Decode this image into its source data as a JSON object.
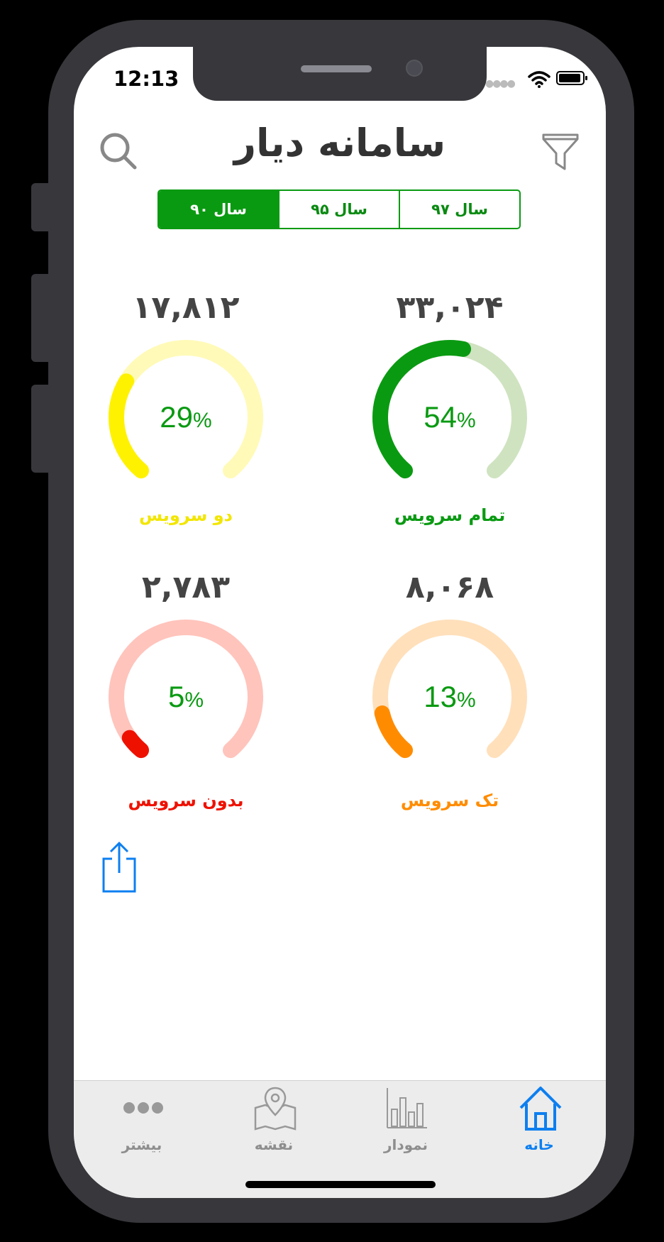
{
  "status_bar": {
    "time": "12:13"
  },
  "header": {
    "title": "سامانه دیار"
  },
  "year_tabs": [
    {
      "label": "سال ۹۷",
      "active": false
    },
    {
      "label": "سال ۹۵",
      "active": false
    },
    {
      "label": "سال ۹۰",
      "active": true
    }
  ],
  "gauges": [
    {
      "id": "full",
      "count": "۳۳,۰۲۴",
      "percent": 54,
      "percent_text": "54",
      "label": "تمام سرویس",
      "color": "#0a9a12",
      "track": "#cfe3c0",
      "label_color": "#0a9a12"
    },
    {
      "id": "two",
      "count": "۱۷,۸۱۲",
      "percent": 29,
      "percent_text": "29",
      "label": "دو سرویس",
      "color": "#fff200",
      "track": "#fffab8",
      "label_color": "#f2e600"
    },
    {
      "id": "single",
      "count": "۸,۰۶۸",
      "percent": 13,
      "percent_text": "13",
      "label": "تک سرویس",
      "color": "#ff8c00",
      "track": "#ffe0bb",
      "label_color": "#ff8c00"
    },
    {
      "id": "none",
      "count": "۲,۷۸۳",
      "percent": 5,
      "percent_text": "5",
      "label": "بدون سرویس",
      "color": "#ee1100",
      "track": "#ffc4bc",
      "label_color": "#ee1100"
    }
  ],
  "percent_sign": "%",
  "percent_color": "#0a9a12",
  "tabbar": [
    {
      "label": "خانه",
      "icon": "home-icon",
      "active": true
    },
    {
      "label": "نمودار",
      "icon": "bar-chart-icon",
      "active": false
    },
    {
      "label": "نقشه",
      "icon": "map-icon",
      "active": false
    },
    {
      "label": "بیشتر",
      "icon": "more-icon",
      "active": false
    }
  ]
}
